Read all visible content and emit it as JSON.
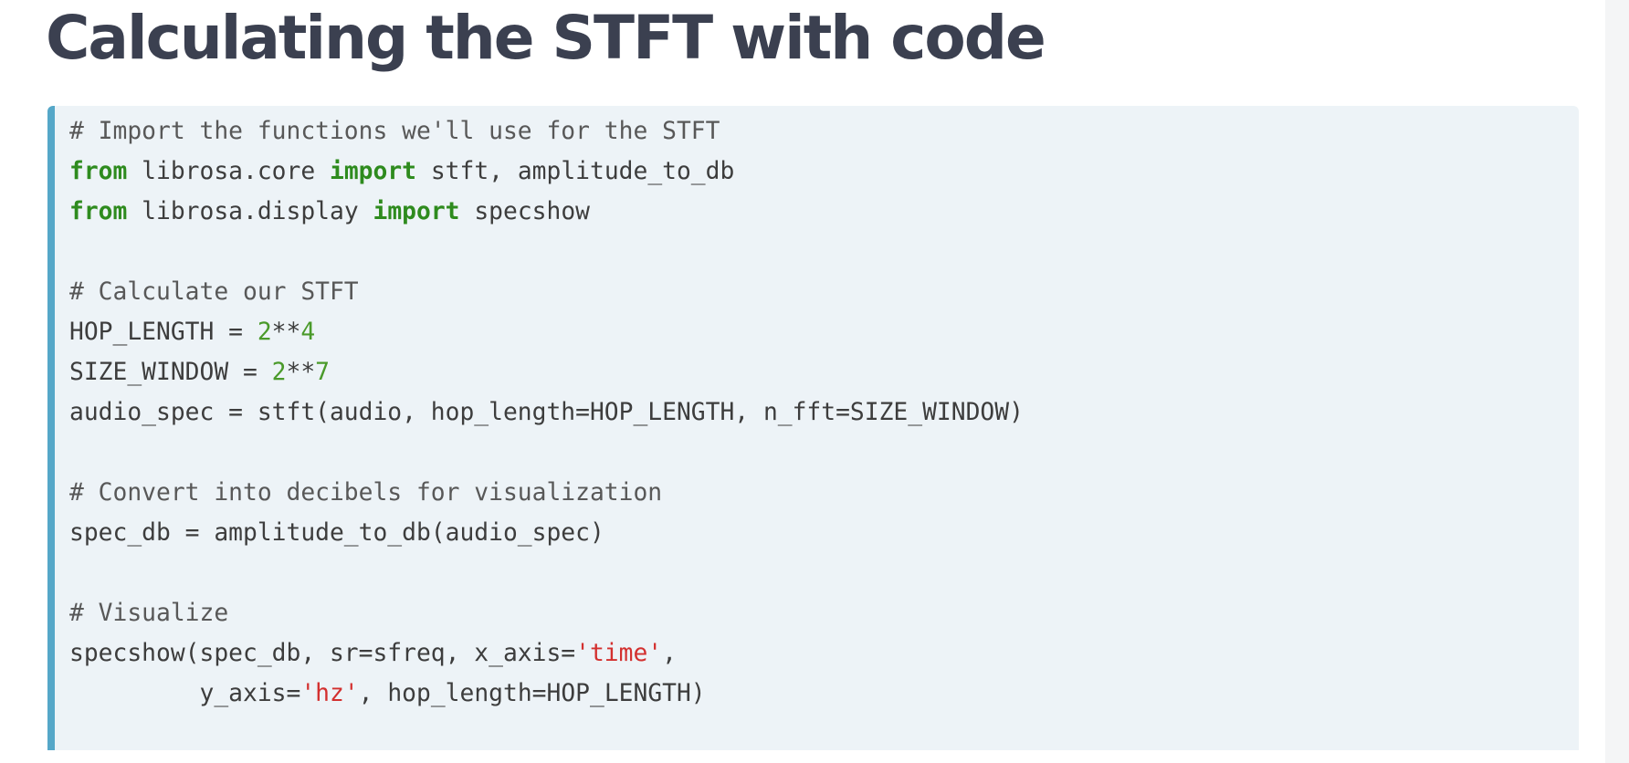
{
  "page": {
    "title": "Calculating the STFT with code"
  },
  "code": {
    "language": "python",
    "lines": {
      "l1": {
        "comment": "# Import the functions we'll use for the STFT"
      },
      "l2": {
        "kw1": "from",
        "t1": " librosa.core ",
        "kw2": "import",
        "t2": " stft, amplitude_to_db"
      },
      "l3": {
        "kw1": "from",
        "t1": " librosa.display ",
        "kw2": "import",
        "t2": " specshow"
      },
      "l5": {
        "comment": "# Calculate our STFT"
      },
      "l6": {
        "t1": "HOP_LENGTH = ",
        "n1": "2",
        "t2": "**",
        "n2": "4"
      },
      "l7": {
        "t1": "SIZE_WINDOW = ",
        "n1": "2",
        "t2": "**",
        "n2": "7"
      },
      "l8": {
        "t1": "audio_spec = stft(audio, hop_length=HOP_LENGTH, n_fft=SIZE_WINDOW)"
      },
      "l10": {
        "comment": "# Convert into decibels for visualization"
      },
      "l11": {
        "t1": "spec_db = amplitude_to_db(audio_spec)"
      },
      "l13": {
        "comment": "# Visualize"
      },
      "l14": {
        "t1": "specshow(spec_db, sr=sfreq, x_axis=",
        "s1": "'time'",
        "t2": ","
      },
      "l15": {
        "t1": "         y_axis=",
        "s1": "'hz'",
        "t2": ", hop_length=HOP_LENGTH)"
      }
    }
  },
  "colors": {
    "title": "#3b4050",
    "code_background": "#edf3f7",
    "code_accent_border": "#55a7c8",
    "keyword": "#2e8b1e",
    "number": "#4a9a2a",
    "string": "#d3302f",
    "comment": "#585858"
  }
}
